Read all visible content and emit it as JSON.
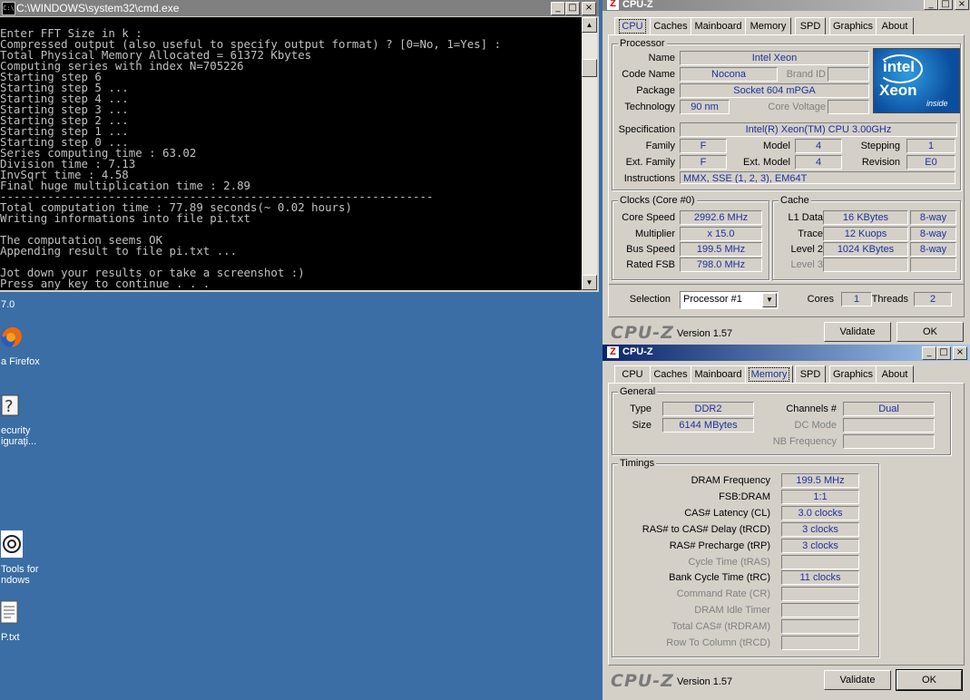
{
  "cmd": {
    "title": "C:\\WINDOWS\\system32\\cmd.exe",
    "icon": "C:\\",
    "lines": [
      "",
      "Enter FFT Size in k :",
      "Compressed output (also useful to specify output format) ? [0=No, 1=Yes] :",
      "Total Physical Memory Allocated = 61372 Kbytes",
      "Computing series with index N=705226",
      "Starting step 6",
      "Starting step 5 ...",
      "Starting step 4 ...",
      "Starting step 3 ...",
      "Starting step 2 ...",
      "Starting step 1 ...",
      "Starting step 0 ...",
      "Series computing time : 63.02",
      "Division time : 7.13",
      "InvSqrt time : 4.58",
      "Final huge multiplication time : 2.89",
      "----------------------------------------------------------------",
      "Total computation time : 77.89 seconds(~ 0.02 hours)",
      "Writing informations into file pi.txt",
      "",
      "The computation seems OK",
      "Appending result to file pi.txt ...",
      "",
      "Jot down your results or take a screenshot :)",
      "Press any key to continue . . ."
    ],
    "btn_min": "_",
    "btn_max": "□",
    "btn_close": "×"
  },
  "desktop": {
    "version_text": "7.0",
    "icons": [
      {
        "label": "a Firefox"
      },
      {
        "label": "ecurity\niguraţi..."
      },
      {
        "label": "Tools for\nndows"
      },
      {
        "label": "P.txt"
      }
    ]
  },
  "cpuz": {
    "title": "CPU-Z",
    "tabs": [
      "CPU",
      "Caches",
      "Mainboard",
      "Memory",
      "SPD",
      "Graphics",
      "About"
    ],
    "logo": "CPU-Z",
    "version": "Version 1.57",
    "validate": "Validate",
    "ok": "OK",
    "intel_logo": {
      "brand": "intel",
      "product": "Xeon",
      "tag": "inside"
    },
    "processor": {
      "group": "Processor",
      "name_label": "Name",
      "name": "Intel Xeon",
      "codename_label": "Code Name",
      "codename": "Nocona",
      "brandid_label": "Brand ID",
      "brandid": "",
      "package_label": "Package",
      "package": "Socket 604 mPGA",
      "technology_label": "Technology",
      "technology": "90 nm",
      "corevoltage_label": "Core Voltage",
      "corevoltage": "",
      "spec_label": "Specification",
      "spec": "Intel(R) Xeon(TM) CPU 3.00GHz",
      "family_label": "Family",
      "family": "F",
      "model_label": "Model",
      "model": "4",
      "stepping_label": "Stepping",
      "stepping": "1",
      "extfamily_label": "Ext. Family",
      "extfamily": "F",
      "extmodel_label": "Ext. Model",
      "extmodel": "4",
      "revision_label": "Revision",
      "revision": "E0",
      "instructions_label": "Instructions",
      "instructions": "MMX, SSE (1, 2, 3), EM64T"
    },
    "clocks": {
      "group": "Clocks (Core #0)",
      "corespeed_label": "Core Speed",
      "corespeed": "2992.6 MHz",
      "multiplier_label": "Multiplier",
      "multiplier": "x 15.0",
      "busspeed_label": "Bus Speed",
      "busspeed": "199.5 MHz",
      "ratedfsb_label": "Rated FSB",
      "ratedfsb": "798.0 MHz"
    },
    "cache": {
      "group": "Cache",
      "l1_label": "L1 Data",
      "l1": "16 KBytes",
      "l1_way": "8-way",
      "trace_label": "Trace",
      "trace": "12 Kuops",
      "trace_way": "8-way",
      "l2_label": "Level 2",
      "l2": "1024 KBytes",
      "l2_way": "8-way",
      "l3_label": "Level 3",
      "l3": "",
      "l3_way": ""
    },
    "selection": {
      "label": "Selection",
      "value": "Processor #1",
      "cores_label": "Cores",
      "cores": "1",
      "threads_label": "Threads",
      "threads": "2"
    },
    "memory": {
      "general_group": "General",
      "type_label": "Type",
      "type": "DDR2",
      "size_label": "Size",
      "size": "6144 MBytes",
      "channels_label": "Channels #",
      "channels": "Dual",
      "dcmode_label": "DC Mode",
      "dcmode": "",
      "nbfreq_label": "NB Frequency",
      "nbfreq": "",
      "timings_group": "Timings",
      "timings": [
        {
          "label": "DRAM Frequency",
          "value": "199.5 MHz",
          "disabled": false
        },
        {
          "label": "FSB:DRAM",
          "value": "1:1",
          "disabled": false
        },
        {
          "label": "CAS# Latency (CL)",
          "value": "3.0 clocks",
          "disabled": false
        },
        {
          "label": "RAS# to CAS# Delay (tRCD)",
          "value": "3 clocks",
          "disabled": false
        },
        {
          "label": "RAS# Precharge (tRP)",
          "value": "3 clocks",
          "disabled": false
        },
        {
          "label": "Cycle Time (tRAS)",
          "value": "",
          "disabled": true
        },
        {
          "label": "Bank Cycle Time (tRC)",
          "value": "11 clocks",
          "disabled": false
        },
        {
          "label": "Command Rate (CR)",
          "value": "",
          "disabled": true
        },
        {
          "label": "DRAM Idle Timer",
          "value": "",
          "disabled": true
        },
        {
          "label": "Total CAS# (tRDRAM)",
          "value": "",
          "disabled": true
        },
        {
          "label": "Row To Column (tRCD)",
          "value": "",
          "disabled": true
        }
      ]
    }
  }
}
